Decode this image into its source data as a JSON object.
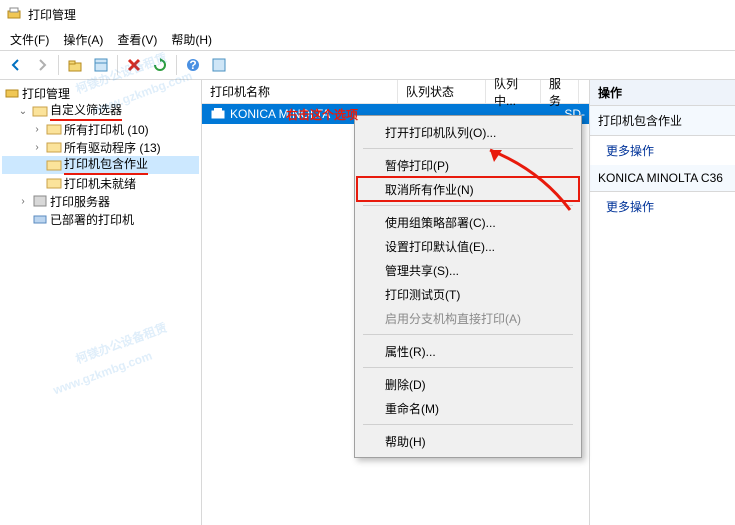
{
  "window": {
    "title": "打印管理"
  },
  "menu": {
    "file": "文件(F)",
    "action": "操作(A)",
    "view": "查看(V)",
    "help": "帮助(H)"
  },
  "tree": {
    "root": "打印管理",
    "custom": "自定义筛选器",
    "allPrinters": "所有打印机 (10)",
    "allDrivers": "所有驱动程序 (13)",
    "withJobs": "打印机包含作业",
    "notReady": "打印机未就绪",
    "servers": "打印服务器",
    "deployed": "已部署的打印机"
  },
  "list": {
    "colPrinter": "打印机名称",
    "colQueueState": "队列状态",
    "colInQueue": "队列中...",
    "colServer": "服务",
    "rowName": "KONICA MINOLTA",
    "rowServer": "SD-"
  },
  "ctx": {
    "openQueue": "打开打印机队列(O)...",
    "pause": "暂停打印(P)",
    "cancelAll": "取消所有作业(N)",
    "gpo": "使用组策略部署(C)...",
    "defaults": "设置打印默认值(E)...",
    "share": "管理共享(S)...",
    "testPage": "打印测试页(T)",
    "branch": "启用分支机构直接打印(A)",
    "props": "属性(R)...",
    "delete": "删除(D)",
    "rename": "重命名(M)",
    "help": "帮助(H)"
  },
  "actions": {
    "head": "操作",
    "group1": "打印机包含作业",
    "more": "更多操作",
    "group2": "KONICA MINOLTA C36"
  },
  "anno": {
    "rightClick": "右击这个选项"
  },
  "wm": {
    "text1": "柯镁办公设备租赁",
    "text2": "www.gzkmbg.com"
  }
}
